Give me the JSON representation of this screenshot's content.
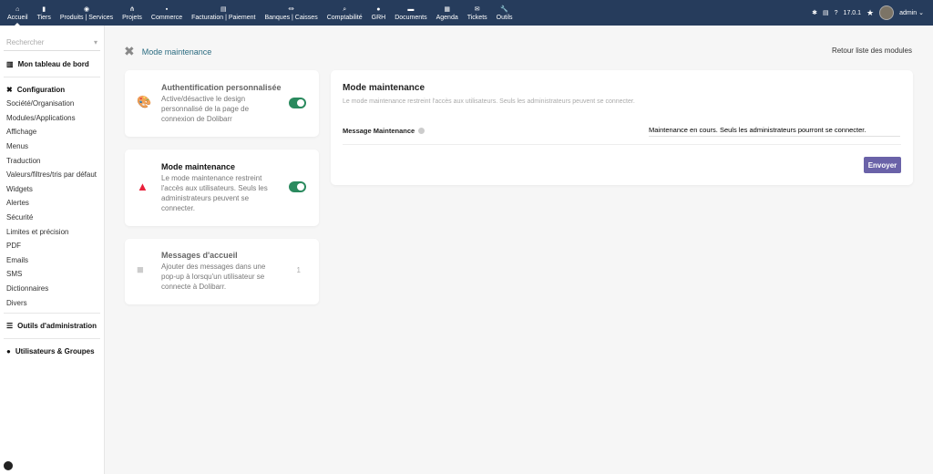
{
  "topbar": {
    "nav": [
      {
        "label": "Accueil",
        "icon": "home-icon",
        "glyph": "⌂"
      },
      {
        "label": "Tiers",
        "icon": "building-icon",
        "glyph": "▮"
      },
      {
        "label": "Produits | Services",
        "icon": "cube-icon",
        "glyph": "◉"
      },
      {
        "label": "Projets",
        "icon": "project-icon",
        "glyph": "⋔"
      },
      {
        "label": "Commerce",
        "icon": "briefcase-icon",
        "glyph": "▪"
      },
      {
        "label": "Facturation | Paiement",
        "icon": "invoice-icon",
        "glyph": "▤"
      },
      {
        "label": "Banques | Caisses",
        "icon": "bank-icon",
        "glyph": "⏛"
      },
      {
        "label": "Comptabilité",
        "icon": "search-dollar-icon",
        "glyph": "⌕"
      },
      {
        "label": "GRH",
        "icon": "user-tie-icon",
        "glyph": "●"
      },
      {
        "label": "Documents",
        "icon": "folder-icon",
        "glyph": "▬"
      },
      {
        "label": "Agenda",
        "icon": "calendar-icon",
        "glyph": "▦"
      },
      {
        "label": "Tickets",
        "icon": "ticket-icon",
        "glyph": "✉"
      },
      {
        "label": "Outils",
        "icon": "wrench-icon",
        "glyph": "🔧"
      }
    ],
    "version": "17.0.1",
    "user": "admin"
  },
  "sidebar": {
    "search_placeholder": "Rechercher",
    "dashboard": "Mon tableau de bord",
    "config": "Configuration",
    "items": [
      "Société/Organisation",
      "Modules/Applications",
      "Affichage",
      "Menus",
      "Traduction",
      "Valeurs/filtres/tris par défaut",
      "Widgets",
      "Alertes",
      "Sécurité",
      "Limites et précision",
      "PDF",
      "Emails",
      "SMS",
      "Dictionnaires",
      "Divers"
    ],
    "admin_tools": "Outils d'administration",
    "users": "Utilisateurs & Groupes"
  },
  "page": {
    "title": "Mode maintenance",
    "back": "Retour liste des modules"
  },
  "cards": [
    {
      "title": "Authentification personnalisée",
      "desc": "Active/désactive le design personnalisé de la page de connexion de Dolibarr",
      "enabled": true
    },
    {
      "title": "Mode maintenance",
      "desc": "Le mode maintenance restreint l'accès aux utilisateurs. Seuls les administrateurs peuvent se connecter.",
      "enabled": true
    },
    {
      "title": "Messages d'accueil",
      "desc": "Ajouter des messages dans une pop-up à lorsqu'un utilisateur se connecte à Dolibarr.",
      "count": "1"
    }
  ],
  "panel": {
    "title": "Mode maintenance",
    "subtitle": "Le mode maintenance restreint l'accès aux utilisateurs. Seuls les administrateurs peuvent se connecter.",
    "field_label": "Message Maintenance",
    "field_value": "Maintenance en cours. Seuls les administrateurs pourront se connecter.",
    "submit": "Envoyer"
  },
  "colors": {
    "topbar": "#263c5c",
    "toggle": "#2a8a5e",
    "button": "#6a62a8",
    "warning": "#e8213b"
  }
}
